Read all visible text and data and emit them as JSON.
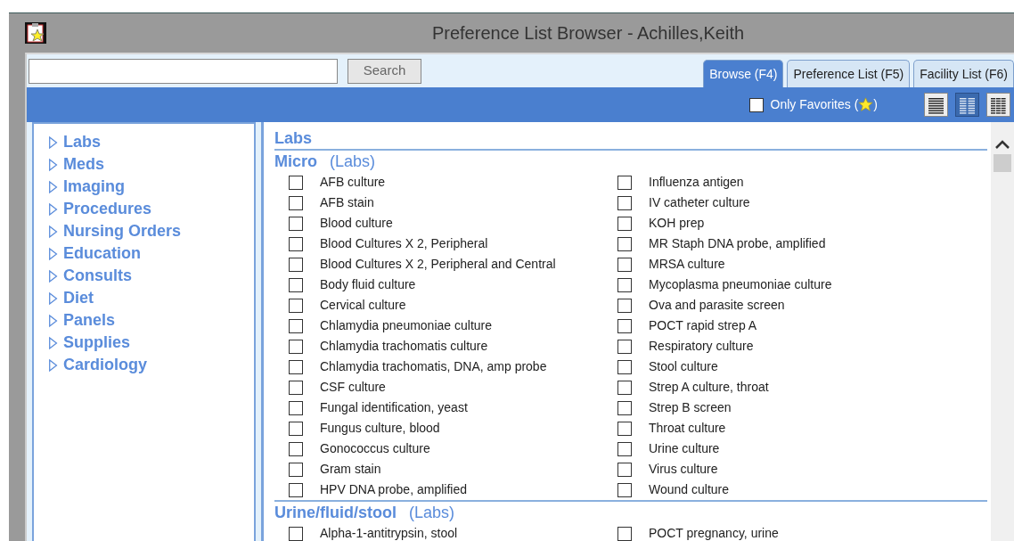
{
  "window": {
    "title": "Preference List Browser - Achilles,Keith"
  },
  "search": {
    "button": "Search"
  },
  "tabs": [
    {
      "label": "Browse (F4)",
      "selected": true
    },
    {
      "label": "Preference List (F5)",
      "selected": false
    },
    {
      "label": "Facility List (F6)",
      "selected": false
    }
  ],
  "only_favorites": {
    "label_before": "Only Favorites (",
    "label_after": ")",
    "checked": false
  },
  "view_modes": [
    {
      "kind": "list",
      "selected": false
    },
    {
      "kind": "columns",
      "selected": true
    },
    {
      "kind": "grid",
      "selected": false
    }
  ],
  "sidebar": {
    "items": [
      {
        "label": "Labs",
        "expanded": false
      },
      {
        "label": "Meds",
        "expanded": false
      },
      {
        "label": "Imaging",
        "expanded": false
      },
      {
        "label": "Procedures",
        "expanded": false
      },
      {
        "label": "Nursing Orders",
        "expanded": false
      },
      {
        "label": "Education",
        "expanded": false
      },
      {
        "label": "Consults",
        "expanded": false
      },
      {
        "label": "Diet",
        "expanded": false
      },
      {
        "label": "Panels",
        "expanded": false
      },
      {
        "label": "Supplies",
        "expanded": false
      },
      {
        "label": "Cardiology",
        "expanded": false
      }
    ]
  },
  "content": {
    "heading": "Labs",
    "sections": [
      {
        "title": "Micro",
        "category": "(Labs)",
        "columns": [
          [
            {
              "label": "AFB culture",
              "checked": false
            },
            {
              "label": "AFB stain",
              "checked": false
            },
            {
              "label": "Blood culture",
              "checked": false
            },
            {
              "label": "Blood Cultures X 2, Peripheral",
              "checked": false
            },
            {
              "label": "Blood Cultures X 2, Peripheral and Central",
              "checked": false
            },
            {
              "label": "Body fluid culture",
              "checked": false
            },
            {
              "label": "Cervical culture",
              "checked": false
            },
            {
              "label": "Chlamydia pneumoniae culture",
              "checked": false
            },
            {
              "label": "Chlamydia trachomatis culture",
              "checked": false
            },
            {
              "label": "Chlamydia trachomatis, DNA, amp probe",
              "checked": false
            },
            {
              "label": "CSF culture",
              "checked": false
            },
            {
              "label": "Fungal identification, yeast",
              "checked": false
            },
            {
              "label": "Fungus culture, blood",
              "checked": false
            },
            {
              "label": "Gonococcus culture",
              "checked": false
            },
            {
              "label": "Gram stain",
              "checked": false
            },
            {
              "label": "HPV DNA probe, amplified",
              "checked": false
            }
          ],
          [
            {
              "label": "Influenza antigen",
              "checked": false
            },
            {
              "label": "IV catheter culture",
              "checked": false
            },
            {
              "label": "KOH prep",
              "checked": false
            },
            {
              "label": "MR Staph DNA probe, amplified",
              "checked": false
            },
            {
              "label": "MRSA culture",
              "checked": false
            },
            {
              "label": "Mycoplasma pneumoniae culture",
              "checked": false
            },
            {
              "label": "Ova and parasite screen",
              "checked": false
            },
            {
              "label": "POCT rapid strep A",
              "checked": false
            },
            {
              "label": "Respiratory culture",
              "checked": false
            },
            {
              "label": "Stool culture",
              "checked": false
            },
            {
              "label": "Strep A culture, throat",
              "checked": false
            },
            {
              "label": "Strep B screen",
              "checked": false
            },
            {
              "label": "Throat culture",
              "checked": false
            },
            {
              "label": "Urine culture",
              "checked": false
            },
            {
              "label": "Virus culture",
              "checked": false
            },
            {
              "label": "Wound culture",
              "checked": false
            }
          ]
        ]
      },
      {
        "title": "Urine/fluid/stool",
        "category": "(Labs)",
        "columns": [
          [
            {
              "label": "Alpha-1-antitrypsin, stool",
              "checked": false
            }
          ],
          [
            {
              "label": "POCT pregnancy, urine",
              "checked": false
            }
          ]
        ]
      }
    ]
  }
}
